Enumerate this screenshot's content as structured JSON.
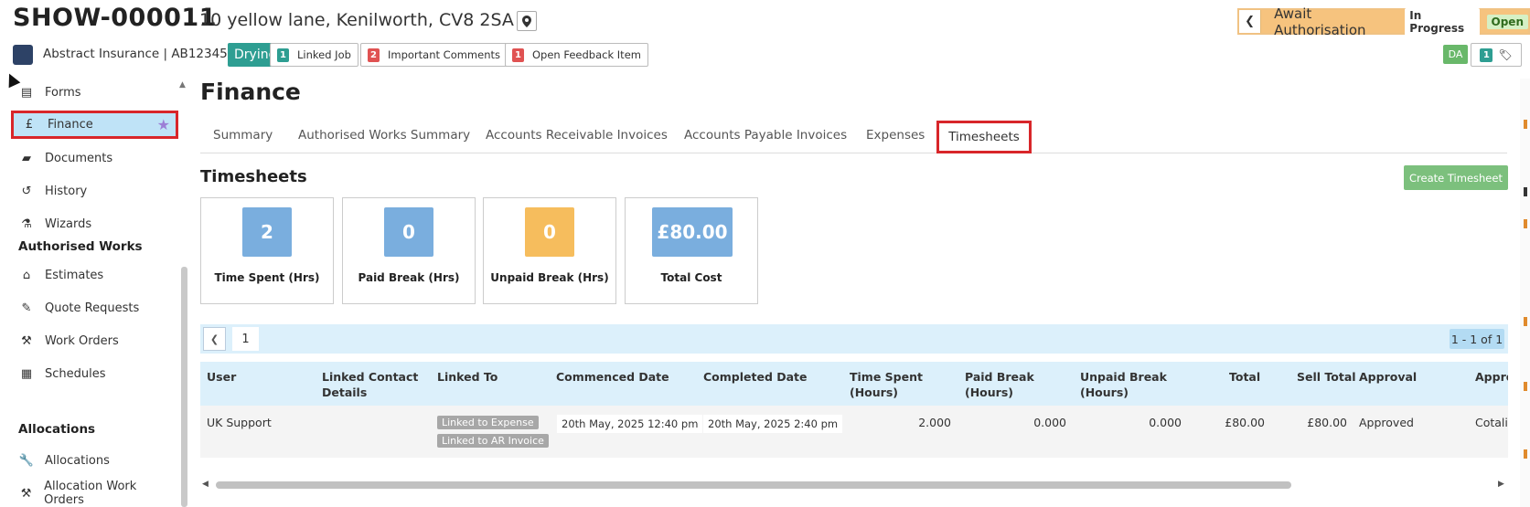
{
  "header": {
    "job_id": "SHOW-000011",
    "address": "10 yellow lane, Kenilworth, CV8 2SA",
    "insurer": "Abstract Insurance | AB123456",
    "status": {
      "label": "Await Authorisation",
      "pill_1": "In Progress",
      "pill_2": "Open"
    },
    "job_state": "Drying",
    "chips": [
      {
        "count": "1",
        "label": "Linked Job",
        "color": "#2e9e92"
      },
      {
        "count": "2",
        "label": "Important Comments",
        "color": "#e05252"
      },
      {
        "count": "1",
        "label": "Open Feedback Item",
        "color": "#e05252"
      }
    ],
    "user_initials": "DA",
    "tag_count": "1"
  },
  "sidebar": {
    "items": [
      {
        "label": "Forms",
        "icon": "file-icon"
      },
      {
        "label": "Finance",
        "icon": "pound-icon",
        "active": true
      },
      {
        "label": "Documents",
        "icon": "folder-icon"
      },
      {
        "label": "History",
        "icon": "history-icon"
      },
      {
        "label": "Wizards",
        "icon": "wizard-icon"
      }
    ],
    "authorised_works_heading": "Authorised Works",
    "authorised_items": [
      {
        "label": "Estimates",
        "icon": "estimate-icon"
      },
      {
        "label": "Quote Requests",
        "icon": "brush-icon"
      },
      {
        "label": "Work Orders",
        "icon": "hammer-icon"
      },
      {
        "label": "Schedules",
        "icon": "calendar-icon"
      }
    ],
    "allocations_heading": "Allocations",
    "allocation_items": [
      {
        "label": "Allocations",
        "icon": "wrench-icon"
      },
      {
        "label": "Allocation Work Orders",
        "icon": "hammer-icon"
      }
    ]
  },
  "main": {
    "title": "Finance",
    "tabs": [
      "Summary",
      "Authorised Works Summary",
      "Accounts Receivable Invoices",
      "Accounts Payable Invoices",
      "Expenses",
      "Timesheets"
    ],
    "active_tab": "Timesheets",
    "section_title": "Timesheets",
    "create_button": "Create Timesheet",
    "stats": [
      {
        "value": "2",
        "label": "Time Spent (Hrs)",
        "color": "#7aaede"
      },
      {
        "value": "0",
        "label": "Paid Break (Hrs)",
        "color": "#7aaede"
      },
      {
        "value": "0",
        "label": "Unpaid Break (Hrs)",
        "color": "#f6bd5d"
      },
      {
        "value": "£80.00",
        "label": "Total Cost",
        "color": "#7aaede"
      }
    ]
  },
  "table": {
    "page": "1",
    "count": "1 - 1 of 1",
    "headers": {
      "user": "User",
      "contact_1": "Linked Contact",
      "contact_2": "Details",
      "linked_to": "Linked To",
      "commenced": "Commenced Date",
      "completed": "Completed Date",
      "time_1": "Time Spent",
      "time_2": "(Hours)",
      "paid_1": "Paid Break",
      "paid_2": "(Hours)",
      "unpaid_1": "Unpaid Break",
      "unpaid_2": "(Hours)",
      "total": "Total",
      "sell_total": "Sell Total",
      "approval": "Approval",
      "approved_by": "Appro"
    },
    "row": {
      "user": "UK Support",
      "linked_1": "Linked to Expense",
      "linked_2": "Linked to AR Invoice",
      "commenced": "20th May, 2025 12:40 pm",
      "completed": "20th May, 2025 2:40 pm",
      "time_spent": "2.000",
      "paid_break": "0.000",
      "unpaid_break": "0.000",
      "total": "£80.00",
      "sell_total": "£80.00",
      "approval": "Approved",
      "approved_by": "Cotalit"
    }
  }
}
